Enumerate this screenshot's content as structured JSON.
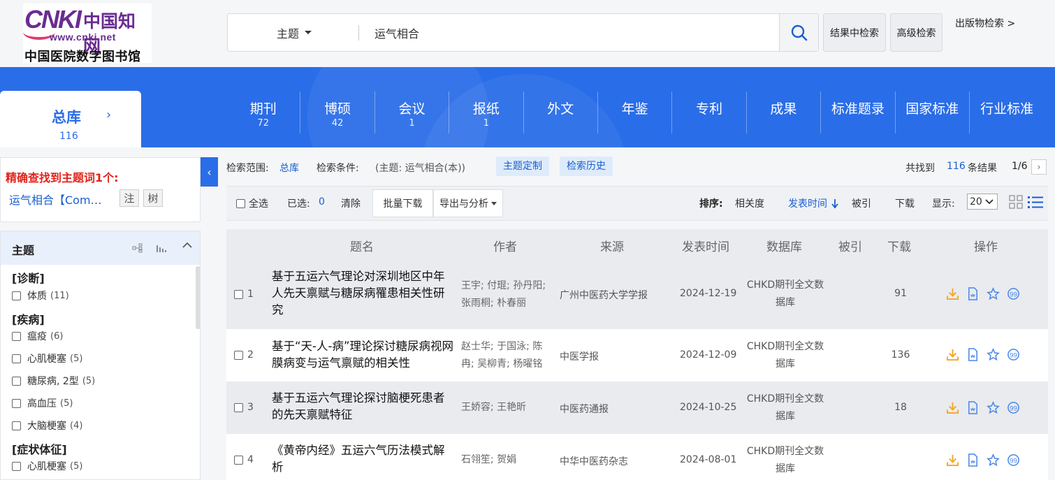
{
  "header": {
    "logo_brand": "CNKI",
    "logo_cn": "中国知网",
    "logo_url": "www.cnki.net",
    "logo_library": "中国医院数字图书馆",
    "search_type": "主题",
    "search_value": "运气相合",
    "btn_in_results": "结果中检索",
    "btn_advanced": "高级检索",
    "pub_search": "出版物检索 >"
  },
  "zongku": {
    "label": "总库",
    "count": "116"
  },
  "tabs": [
    {
      "label": "期刊",
      "count": "72"
    },
    {
      "label": "博硕",
      "count": "42"
    },
    {
      "label": "会议",
      "count": "1"
    },
    {
      "label": "报纸",
      "count": "1"
    },
    {
      "label": "外文",
      "count": ""
    },
    {
      "label": "年鉴",
      "count": ""
    },
    {
      "label": "专利",
      "count": ""
    },
    {
      "label": "成果",
      "count": ""
    },
    {
      "label": "标准题录",
      "count": ""
    },
    {
      "label": "国家标准",
      "count": ""
    },
    {
      "label": "行业标准",
      "count": ""
    }
  ],
  "exact": {
    "title": "精确查找到主题词1个:",
    "term": "运气相合【Com…",
    "btn_note": "注",
    "btn_tree": "树"
  },
  "facet": {
    "title": "主题",
    "groups": [
      {
        "name": "[诊断]",
        "items": [
          {
            "label": "体质",
            "count": "(11)"
          }
        ]
      },
      {
        "name": "[疾病]",
        "items": [
          {
            "label": "瘟疫",
            "count": "(6)"
          },
          {
            "label": "心肌梗塞",
            "count": "(5)"
          },
          {
            "label": "糖尿病, 2型",
            "count": "(5)"
          },
          {
            "label": "高血压",
            "count": "(5)"
          },
          {
            "label": "大脑梗塞",
            "count": "(4)"
          }
        ]
      },
      {
        "name": "[症状体征]",
        "items": [
          {
            "label": "心肌梗塞",
            "count": "(5)"
          }
        ]
      }
    ]
  },
  "crumb": {
    "scope_label": "检索范围:",
    "scope_value": "总库",
    "cond_label": "检索条件:",
    "cond_value": "(主题: 运气相合(本))",
    "btn_custom": "主题定制",
    "btn_history": "检索历史",
    "found_label": "共找到",
    "found_count": "116",
    "found_suffix": "条结果",
    "page": "1/6"
  },
  "toolbar": {
    "select_all": "全选",
    "selected_label": "已选:",
    "selected_count": "0",
    "clear": "清除",
    "batch_download": "批量下载",
    "export": "导出与分析",
    "sort_label": "排序:",
    "sort_relevance": "相关度",
    "sort_date": "发表时间",
    "sort_cited": "被引",
    "sort_download": "下载",
    "display_label": "显示:",
    "display_value": "20"
  },
  "table": {
    "headers": [
      "题名",
      "作者",
      "来源",
      "发表时间",
      "数据库",
      "被引",
      "下载",
      "操作"
    ],
    "rows": [
      {
        "num": "1",
        "title": "基于五运六气理论对深圳地区中年人先天禀赋与糖尿病罹患相关性研究",
        "authors": "王宇; 付琨; 孙丹阳; 张雨桐; 朴春丽",
        "source": "广州中医药大学学报",
        "date": "2024-12-19",
        "db": "CHKD期刊全文数据库",
        "cited": "",
        "downloads": "91"
      },
      {
        "num": "2",
        "title": "基于“天-人-病”理论探讨糖尿病视网膜病变与运气禀赋的相关性",
        "authors": "赵士华; 于国泳; 陈冉; 吴柳青; 杨曜铭",
        "source": "中医学报",
        "date": "2024-12-09",
        "db": "CHKD期刊全文数据库",
        "cited": "",
        "downloads": "136"
      },
      {
        "num": "3",
        "title": "基于五运六气理论探讨脑梗死患者的先天禀赋特征",
        "authors": "王娇容; 王艳昕",
        "source": "中医药通报",
        "date": "2024-10-25",
        "db": "CHKD期刊全文数据库",
        "cited": "",
        "downloads": "18"
      },
      {
        "num": "4",
        "title": "《黄帝内经》五运六气历法模式解析",
        "authors": "石翎笙; 贺娟",
        "source": "中华中医药杂志",
        "date": "2024-08-01",
        "db": "CHKD期刊全文数据库",
        "cited": "",
        "downloads": ""
      }
    ]
  },
  "colors": {
    "brand_blue": "#2a6de8",
    "link_blue": "#1a5fd0",
    "alert_red": "#e2231a",
    "download_orange": "#f5a623"
  }
}
